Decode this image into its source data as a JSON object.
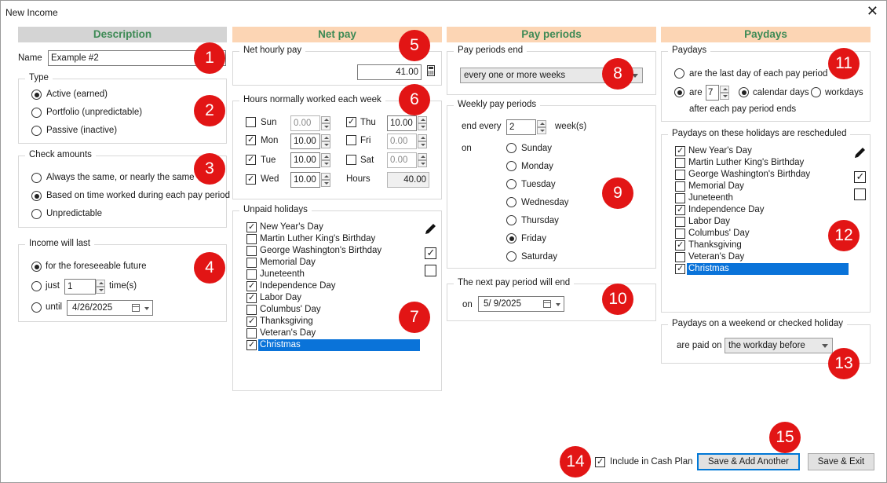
{
  "window": {
    "title": "New Income"
  },
  "headers": {
    "description": "Description",
    "net_pay": "Net pay",
    "pay_periods": "Pay periods",
    "paydays": "Paydays"
  },
  "description": {
    "name_label": "Name",
    "name_value": "Example #2",
    "type": {
      "legend": "Type",
      "options": [
        "Active (earned)",
        "Portfolio (unpredictable)",
        "Passive (inactive)"
      ],
      "selected": 0
    },
    "check_amounts": {
      "legend": "Check amounts",
      "options": [
        "Always the same, or nearly the same",
        "Based on time worked during each pay period",
        "Unpredictable"
      ],
      "selected": 1
    },
    "income_will_last": {
      "legend": "Income will last",
      "opt_foreseeable": "for the foreseeable future",
      "opt_just": "just",
      "just_value": "1",
      "times_label": "time(s)",
      "opt_until": "until",
      "until_date": "4/26/2025"
    }
  },
  "net_pay": {
    "hourly": {
      "legend": "Net hourly pay",
      "value": "41.00"
    },
    "hours": {
      "legend": "Hours normally worked each week",
      "days": [
        {
          "label": "Sun",
          "checked": false,
          "value": "0.00"
        },
        {
          "label": "Mon",
          "checked": true,
          "value": "10.00"
        },
        {
          "label": "Tue",
          "checked": true,
          "value": "10.00"
        },
        {
          "label": "Wed",
          "checked": true,
          "value": "10.00"
        },
        {
          "label": "Thu",
          "checked": true,
          "value": "10.00"
        },
        {
          "label": "Fri",
          "checked": false,
          "value": "0.00"
        },
        {
          "label": "Sat",
          "checked": false,
          "value": "0.00"
        }
      ],
      "hours_label": "Hours",
      "hours_total": "40.00"
    },
    "unpaid_holidays": {
      "legend": "Unpaid holidays",
      "items": [
        {
          "name": "New Year's Day",
          "checked": true
        },
        {
          "name": "Martin Luther King's Birthday",
          "checked": false
        },
        {
          "name": "George Washington's Birthday",
          "checked": false
        },
        {
          "name": "Memorial Day",
          "checked": false
        },
        {
          "name": "Juneteenth",
          "checked": false
        },
        {
          "name": "Independence Day",
          "checked": true
        },
        {
          "name": "Labor Day",
          "checked": true
        },
        {
          "name": "Columbus' Day",
          "checked": false
        },
        {
          "name": "Thanksgiving",
          "checked": true
        },
        {
          "name": "Veteran's Day",
          "checked": false
        },
        {
          "name": "Christmas",
          "checked": true,
          "selected": true
        }
      ]
    }
  },
  "pay_periods": {
    "end": {
      "legend": "Pay periods end",
      "value": "every one or more weeks"
    },
    "weekly": {
      "legend": "Weekly pay periods",
      "end_every_label": "end every",
      "end_every_value": "2",
      "weeks_label": "week(s)",
      "on_label": "on",
      "days": [
        "Sunday",
        "Monday",
        "Tuesday",
        "Wednesday",
        "Thursday",
        "Friday",
        "Saturday"
      ],
      "selected": 5
    },
    "next": {
      "legend": "The next pay period will end",
      "on_label": "on",
      "date": "5/ 9/2025"
    }
  },
  "paydays": {
    "paydays": {
      "legend": "Paydays",
      "opt_last": "are the last day of each pay period",
      "opt_are": "are",
      "are_value": "7",
      "opt_calendar": "calendar days",
      "opt_workdays": "workdays",
      "after_text": "after each pay period ends"
    },
    "rescheduled": {
      "legend": "Paydays on these holidays are rescheduled",
      "items": [
        {
          "name": "New Year's Day",
          "checked": true
        },
        {
          "name": "Martin Luther King's Birthday",
          "checked": false
        },
        {
          "name": "George Washington's Birthday",
          "checked": false
        },
        {
          "name": "Memorial Day",
          "checked": false
        },
        {
          "name": "Juneteenth",
          "checked": false
        },
        {
          "name": "Independence Day",
          "checked": true
        },
        {
          "name": "Labor Day",
          "checked": false
        },
        {
          "name": "Columbus' Day",
          "checked": false
        },
        {
          "name": "Thanksgiving",
          "checked": true
        },
        {
          "name": "Veteran's Day",
          "checked": false
        },
        {
          "name": "Christmas",
          "checked": true,
          "selected": true
        }
      ]
    },
    "weekend": {
      "legend": "Paydays on a weekend or checked holiday",
      "are_paid_on_label": "are paid on",
      "value": "the workday before"
    }
  },
  "footer": {
    "include_label": "Include in Cash Plan",
    "include_checked": true,
    "save_add_label": "Save & Add Another",
    "save_exit_label": "Save & Exit"
  },
  "badges": [
    "1",
    "2",
    "3",
    "4",
    "5",
    "6",
    "7",
    "8",
    "9",
    "10",
    "11",
    "12",
    "13",
    "14",
    "15"
  ],
  "colors": {
    "header_text": "#3d8a55",
    "header_orange": "#fcd5b4",
    "header_gray": "#d4d4d4",
    "badge": "#e21515",
    "selection": "#0a73d9"
  }
}
